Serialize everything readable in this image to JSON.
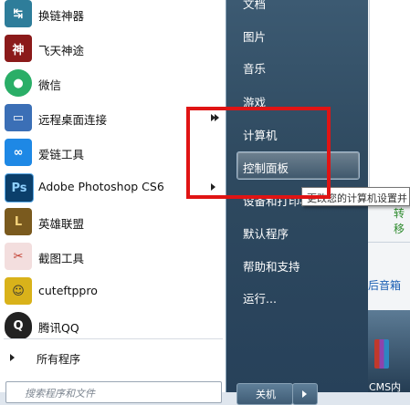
{
  "programs": [
    {
      "label": "换链神器",
      "icon": "link-swap-icon",
      "color": "#2e7d9a",
      "glyph": "↹"
    },
    {
      "label": "飞天神途",
      "icon": "game-feitian-icon",
      "color": "#8b1a1a",
      "glyph": "神"
    },
    {
      "label": "微信",
      "icon": "wechat-icon",
      "color": "#2aae67",
      "glyph": "●"
    },
    {
      "label": "远程桌面连接",
      "icon": "remote-desktop-icon",
      "color": "#3b6fb6",
      "glyph": "▭"
    },
    {
      "label": "爱链工具",
      "icon": "chain-link-icon",
      "color": "#1e88e5",
      "glyph": "∞"
    },
    {
      "label": "Adobe Photoshop CS6",
      "icon": "photoshop-icon",
      "color": "#0b3f6b",
      "glyph": "Ps"
    },
    {
      "label": "英雄联盟",
      "icon": "league-of-legends-icon",
      "color": "#7a5a1e",
      "glyph": "L"
    },
    {
      "label": "截图工具",
      "icon": "scissors-icon",
      "color": "#d4545a",
      "glyph": "✂"
    },
    {
      "label": "cuteftppro",
      "icon": "cuteftp-icon",
      "color": "#d9b21a",
      "glyph": "☺"
    },
    {
      "label": "腾讯QQ",
      "icon": "qq-penguin-icon",
      "color": "#222222",
      "glyph": "Q"
    }
  ],
  "all_programs": "所有程序",
  "search": {
    "placeholder": "搜索程序和文件"
  },
  "places": [
    {
      "label": "文档"
    },
    {
      "label": "图片"
    },
    {
      "label": "音乐"
    },
    {
      "label": "游戏"
    },
    {
      "label": "计算机"
    },
    {
      "label": "控制面板"
    },
    {
      "label": "设备和打印机"
    },
    {
      "label": "默认程序"
    },
    {
      "label": "帮助和支持"
    },
    {
      "label": "运行..."
    }
  ],
  "shutdown": {
    "label": "关机"
  },
  "tooltip": {
    "text": "更改您的计算机设置并"
  },
  "background": {
    "text1": "转移",
    "link": "后音箱",
    "thumb_label": "CMS内"
  },
  "colors": {
    "annotation": "#e01414",
    "menu_left_bg": "#ffffff",
    "menu_right_bg": "#2f4a60"
  }
}
